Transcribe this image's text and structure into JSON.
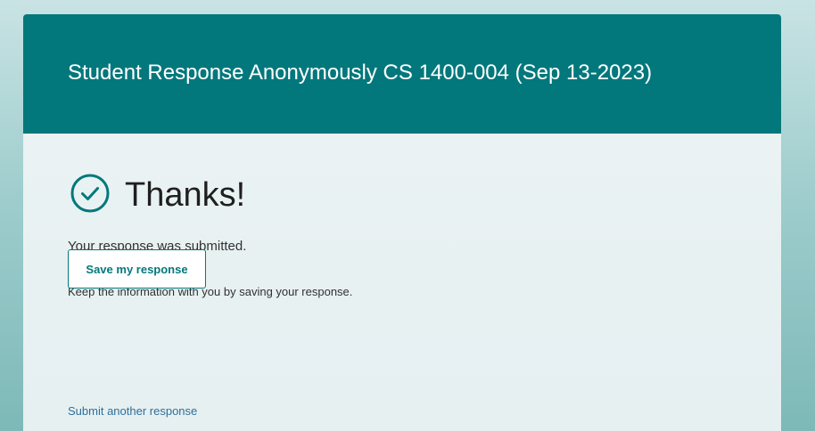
{
  "form": {
    "title": "Student Response Anonymously CS 1400-004 (Sep 13-2023)"
  },
  "confirmation": {
    "icon": "check-circle-icon",
    "heading": "Thanks!",
    "submitted_message": "Your response was submitted.",
    "keep_info_message": "Keep the information with you by saving your response.",
    "save_button_label": "Save my response",
    "submit_another_label": "Submit another response"
  },
  "colors": {
    "accent": "#03787c",
    "link": "#2f6f9a"
  }
}
